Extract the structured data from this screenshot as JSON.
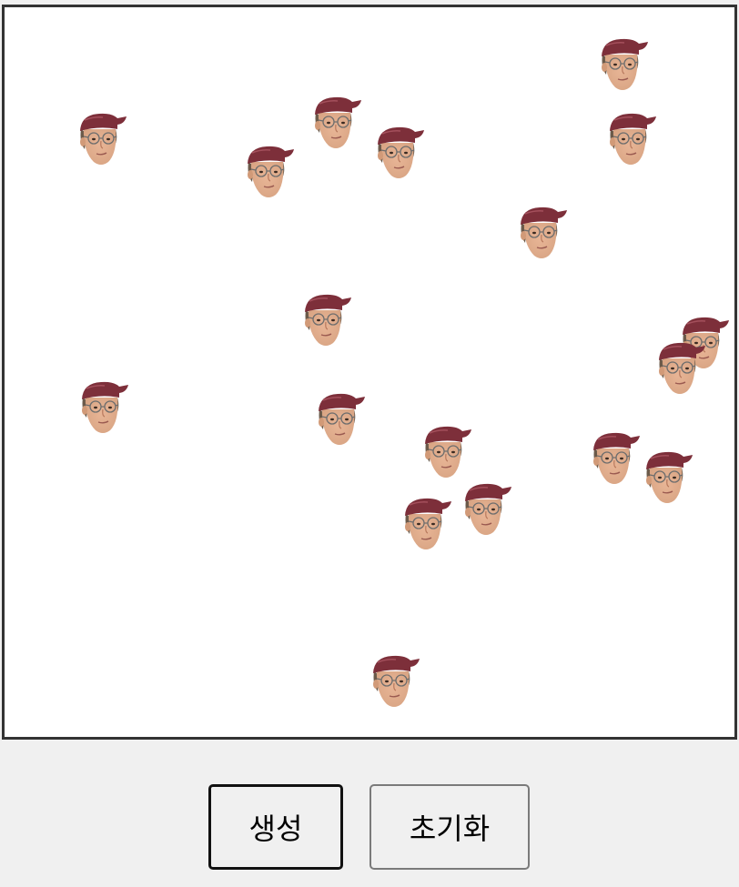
{
  "buttons": {
    "generate_label": "생성",
    "reset_label": "초기화"
  },
  "colors": {
    "stage_border": "#333333",
    "page_background": "#f0f0f0",
    "cap": "#7d2f3a",
    "skin": "#d9a584"
  },
  "sprite_icon": "face-with-cap-and-glasses-icon",
  "sprite_count": 19
}
